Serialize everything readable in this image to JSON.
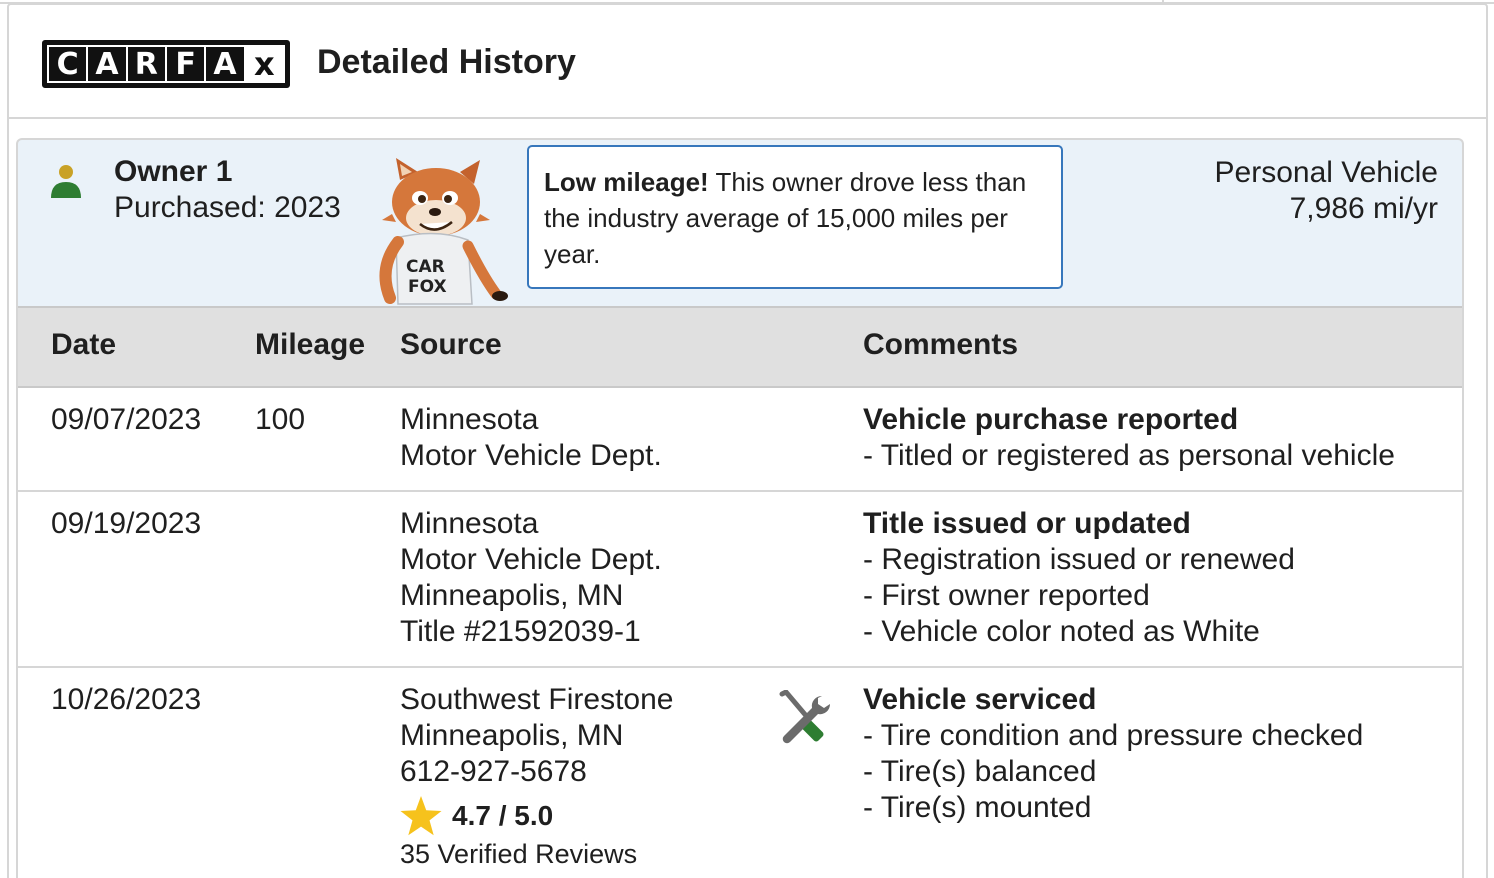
{
  "header": {
    "logo_letters": [
      "C",
      "A",
      "R",
      "F",
      "A",
      "x"
    ],
    "title": "Detailed History"
  },
  "owner": {
    "name": "Owner 1",
    "purchased": "Purchased: 2023",
    "fox_shirt": "CAR FOX",
    "callout_bold": "Low mileage!",
    "callout_text": " This owner drove less than the industry average of 15,000 miles per year.",
    "vehicle_type": "Personal Vehicle",
    "miles_per_year": "7,986 mi/yr"
  },
  "table": {
    "headers": {
      "date": "Date",
      "mileage": "Mileage",
      "source": "Source",
      "comments": "Comments"
    },
    "rows": [
      {
        "date": "09/07/2023",
        "mileage": "100",
        "source": [
          "Minnesota",
          "Motor Vehicle Dept."
        ],
        "comment_title": "Vehicle purchase reported",
        "comment_items": [
          "- Titled or registered as personal vehicle"
        ]
      },
      {
        "date": "09/19/2023",
        "mileage": "",
        "source": [
          "Minnesota",
          "Motor Vehicle Dept.",
          "Minneapolis, MN",
          "Title #21592039-1"
        ],
        "comment_title": "Title issued or updated",
        "comment_items": [
          "- Registration issued or renewed",
          "- First owner reported",
          "- Vehicle color noted as White"
        ]
      },
      {
        "date": "10/26/2023",
        "mileage": "",
        "source": [
          "Southwest Firestone",
          "Minneapolis, MN",
          "612-927-5678"
        ],
        "rating": "4.7 / 5.0",
        "reviews": "35 Verified Reviews",
        "icon": "wrench-screwdriver-icon",
        "comment_title": "Vehicle serviced",
        "comment_items": [
          "- Tire condition and pressure checked",
          "- Tire(s) balanced",
          "- Tire(s) mounted"
        ]
      }
    ]
  },
  "colors": {
    "owner_bg": "#eaf2f9",
    "callout_border": "#3777bc",
    "header_row_bg": "#e0e0e0",
    "person_head": "#c9a227",
    "person_body": "#2e7d32",
    "star": "#f6c21c"
  }
}
